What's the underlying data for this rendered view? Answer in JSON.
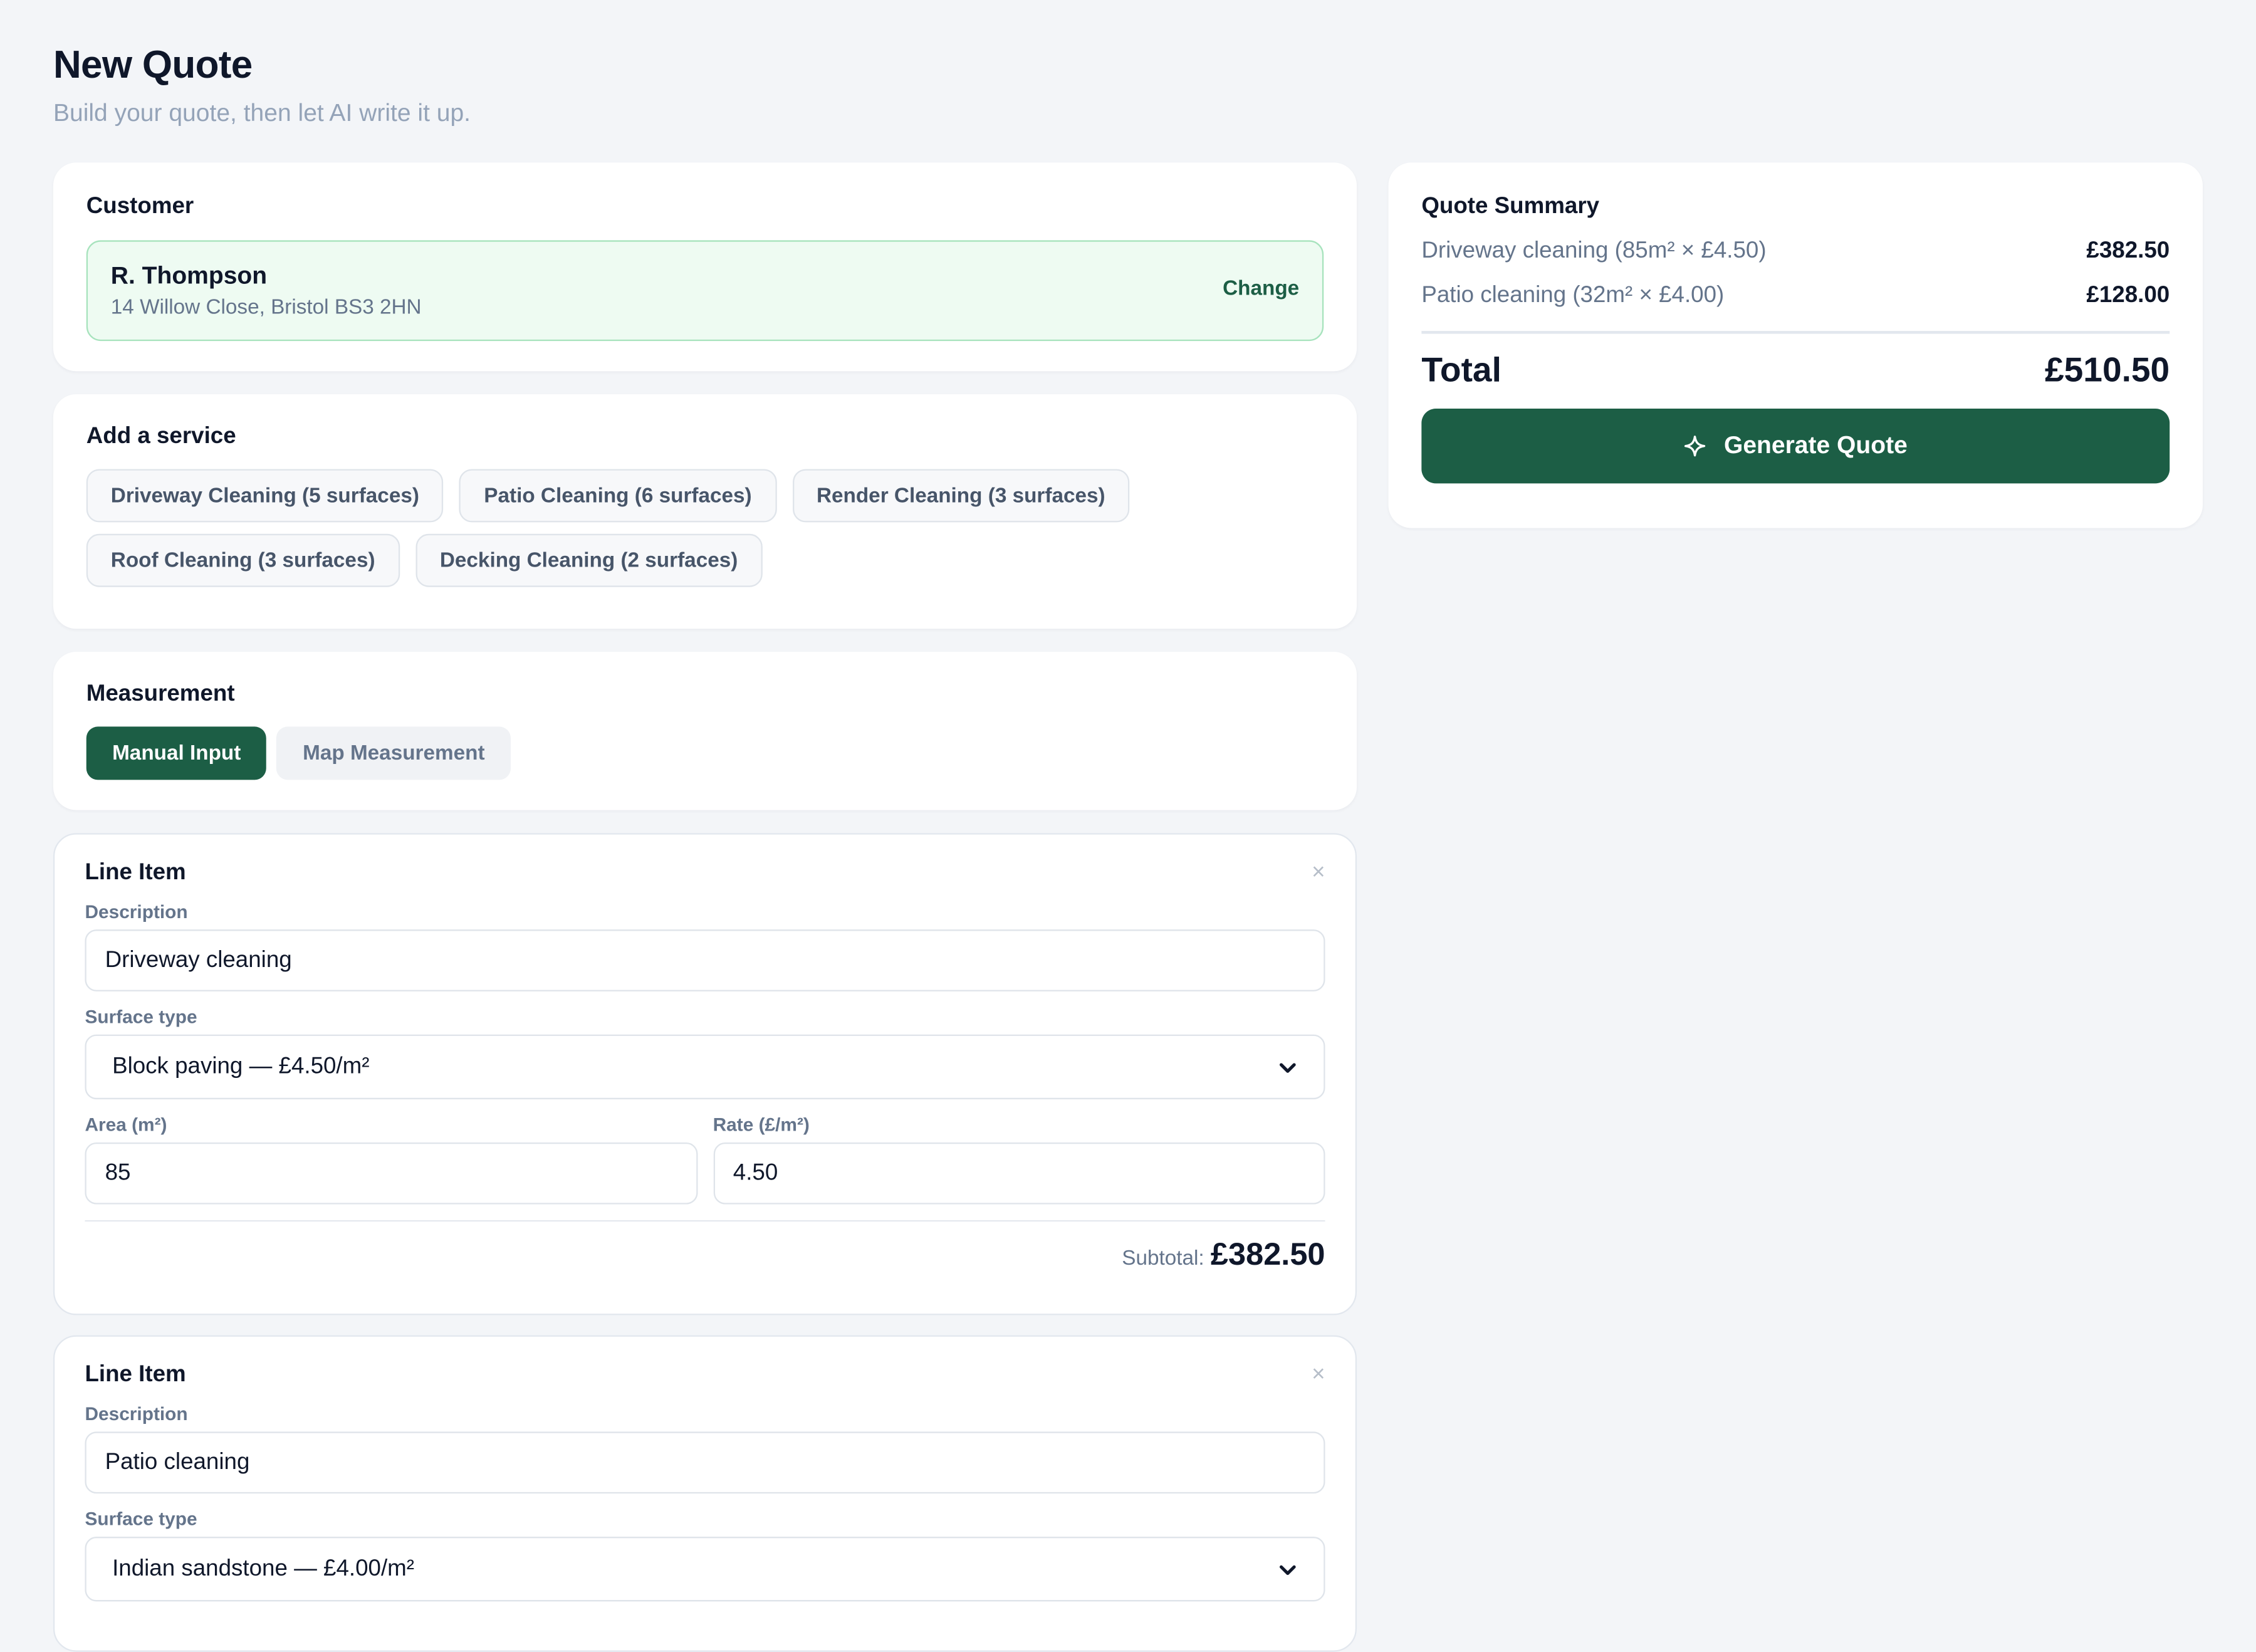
{
  "header": {
    "title": "New Quote",
    "subtitle": "Build your quote, then let AI write it up."
  },
  "customer": {
    "heading": "Customer",
    "name": "R. Thompson",
    "address": "14 Willow Close, Bristol BS3 2HN",
    "change_label": "Change"
  },
  "services": {
    "heading": "Add a service",
    "items": [
      "Driveway Cleaning (5 surfaces)",
      "Patio Cleaning (6 surfaces)",
      "Render Cleaning (3 surfaces)",
      "Roof Cleaning (3 surfaces)",
      "Decking Cleaning (2 surfaces)"
    ]
  },
  "measurement": {
    "heading": "Measurement",
    "options": [
      "Manual Input",
      "Map Measurement"
    ],
    "selected": "Manual Input"
  },
  "line_items": [
    {
      "title": "Line Item",
      "close_icon": "×",
      "description_label": "Description",
      "description": "Driveway cleaning",
      "surface_label": "Surface type",
      "surface": "Block paving — £4.50/m²",
      "area_label": "Area (m²)",
      "area": "85",
      "rate_label": "Rate (£/m²)",
      "rate": "4.50",
      "subtotal_label": "Subtotal:",
      "subtotal": "£382.50"
    },
    {
      "title": "Line Item",
      "close_icon": "×",
      "description_label": "Description",
      "description": "Patio cleaning",
      "surface_label": "Surface type",
      "surface": "Indian sandstone — £4.00/m²"
    }
  ],
  "summary": {
    "heading": "Quote Summary",
    "rows": [
      {
        "desc": "Driveway cleaning (85m² × £4.50)",
        "amount": "£382.50"
      },
      {
        "desc": "Patio cleaning (32m² × £4.00)",
        "amount": "£128.00"
      }
    ],
    "total_label": "Total",
    "total": "£510.50",
    "generate_label": "Generate Quote",
    "generate_icon": "sparkle-icon"
  },
  "colors": {
    "accent": "#1c5e45",
    "customer_bg": "#eefbf2",
    "customer_border": "#a7e3bd",
    "page_bg": "#f3f5f8"
  }
}
